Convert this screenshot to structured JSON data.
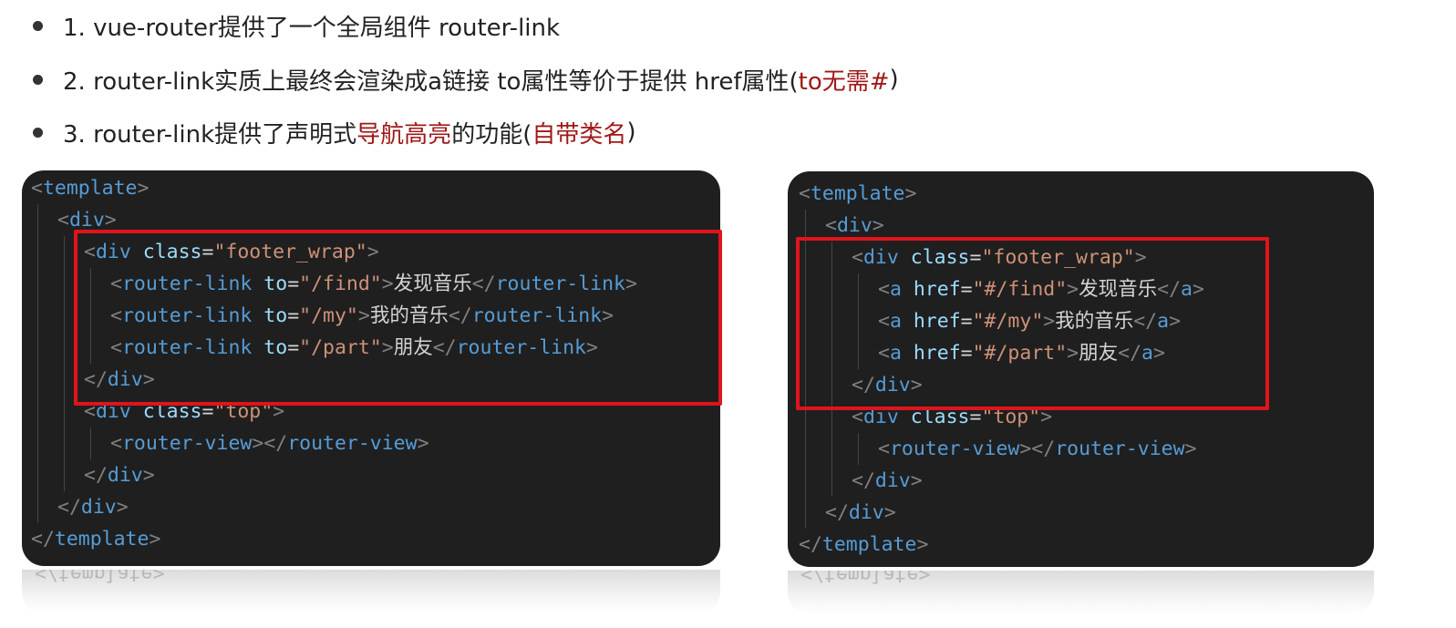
{
  "bullets": [
    {
      "text": "1. vue-router提供了一个全局组件 router-link"
    },
    {
      "pre": "2. router-link实质上最终会渲染成a链接 to属性等价于提供 href属性(",
      "red": "to无需#",
      "post": ")"
    },
    {
      "pre": "3. router-link提供了声明式",
      "red1": "导航高亮",
      "mid": "的功能(",
      "red2": "自带类名",
      "post": ")"
    }
  ],
  "left_code": [
    {
      "i": 0,
      "tokens": [
        [
          "p",
          "<"
        ],
        [
          "t",
          "template"
        ],
        [
          "p",
          ">"
        ]
      ]
    },
    {
      "i": 1,
      "tokens": [
        [
          "p",
          "<"
        ],
        [
          "t",
          "div"
        ],
        [
          "p",
          ">"
        ]
      ]
    },
    {
      "i": 2,
      "tokens": [
        [
          "p",
          "<"
        ],
        [
          "t",
          "div"
        ],
        [
          "x",
          " "
        ],
        [
          "a",
          "class"
        ],
        [
          "x",
          "="
        ],
        [
          "s",
          "\"footer_wrap\""
        ],
        [
          "p",
          ">"
        ]
      ]
    },
    {
      "i": 3,
      "tokens": [
        [
          "p",
          "<"
        ],
        [
          "t",
          "router-link"
        ],
        [
          "x",
          " "
        ],
        [
          "a",
          "to"
        ],
        [
          "x",
          "="
        ],
        [
          "s",
          "\"/find\""
        ],
        [
          "p",
          ">"
        ],
        [
          "x",
          "发现音乐"
        ],
        [
          "p",
          "</"
        ],
        [
          "t",
          "router-link"
        ],
        [
          "p",
          ">"
        ]
      ]
    },
    {
      "i": 3,
      "tokens": [
        [
          "p",
          "<"
        ],
        [
          "t",
          "router-link"
        ],
        [
          "x",
          " "
        ],
        [
          "a",
          "to"
        ],
        [
          "x",
          "="
        ],
        [
          "s",
          "\"/my\""
        ],
        [
          "p",
          ">"
        ],
        [
          "x",
          "我的音乐"
        ],
        [
          "p",
          "</"
        ],
        [
          "t",
          "router-link"
        ],
        [
          "p",
          ">"
        ]
      ]
    },
    {
      "i": 3,
      "tokens": [
        [
          "p",
          "<"
        ],
        [
          "t",
          "router-link"
        ],
        [
          "x",
          " "
        ],
        [
          "a",
          "to"
        ],
        [
          "x",
          "="
        ],
        [
          "s",
          "\"/part\""
        ],
        [
          "p",
          ">"
        ],
        [
          "x",
          "朋友"
        ],
        [
          "p",
          "</"
        ],
        [
          "t",
          "router-link"
        ],
        [
          "p",
          ">"
        ]
      ]
    },
    {
      "i": 2,
      "tokens": [
        [
          "p",
          "</"
        ],
        [
          "t",
          "div"
        ],
        [
          "p",
          ">"
        ]
      ]
    },
    {
      "i": 2,
      "tokens": [
        [
          "p",
          "<"
        ],
        [
          "t",
          "div"
        ],
        [
          "x",
          " "
        ],
        [
          "a",
          "class"
        ],
        [
          "x",
          "="
        ],
        [
          "s",
          "\"top\""
        ],
        [
          "p",
          ">"
        ]
      ]
    },
    {
      "i": 3,
      "tokens": [
        [
          "p",
          "<"
        ],
        [
          "t",
          "router-view"
        ],
        [
          "p",
          "></"
        ],
        [
          "t",
          "router-view"
        ],
        [
          "p",
          ">"
        ]
      ]
    },
    {
      "i": 2,
      "tokens": [
        [
          "p",
          "</"
        ],
        [
          "t",
          "div"
        ],
        [
          "p",
          ">"
        ]
      ]
    },
    {
      "i": 1,
      "tokens": [
        [
          "p",
          "</"
        ],
        [
          "t",
          "div"
        ],
        [
          "p",
          ">"
        ]
      ]
    },
    {
      "i": 0,
      "tokens": [
        [
          "p",
          "</"
        ],
        [
          "t",
          "template"
        ],
        [
          "p",
          ">"
        ]
      ]
    }
  ],
  "right_code": [
    {
      "i": 0,
      "tokens": [
        [
          "p",
          "<"
        ],
        [
          "t",
          "template"
        ],
        [
          "p",
          ">"
        ]
      ]
    },
    {
      "i": 1,
      "tokens": [
        [
          "p",
          "<"
        ],
        [
          "t",
          "div"
        ],
        [
          "p",
          ">"
        ]
      ]
    },
    {
      "i": 2,
      "tokens": [
        [
          "p",
          "<"
        ],
        [
          "t",
          "div"
        ],
        [
          "x",
          " "
        ],
        [
          "a",
          "class"
        ],
        [
          "x",
          "="
        ],
        [
          "s",
          "\"footer_wrap\""
        ],
        [
          "p",
          ">"
        ]
      ]
    },
    {
      "i": 3,
      "tokens": [
        [
          "p",
          "<"
        ],
        [
          "t",
          "a"
        ],
        [
          "x",
          " "
        ],
        [
          "a",
          "href"
        ],
        [
          "x",
          "="
        ],
        [
          "s",
          "\"#/find\""
        ],
        [
          "p",
          ">"
        ],
        [
          "x",
          "发现音乐"
        ],
        [
          "p",
          "</"
        ],
        [
          "t",
          "a"
        ],
        [
          "p",
          ">"
        ]
      ]
    },
    {
      "i": 3,
      "tokens": [
        [
          "p",
          "<"
        ],
        [
          "t",
          "a"
        ],
        [
          "x",
          " "
        ],
        [
          "a",
          "href"
        ],
        [
          "x",
          "="
        ],
        [
          "s",
          "\"#/my\""
        ],
        [
          "p",
          ">"
        ],
        [
          "x",
          "我的音乐"
        ],
        [
          "p",
          "</"
        ],
        [
          "t",
          "a"
        ],
        [
          "p",
          ">"
        ]
      ]
    },
    {
      "i": 3,
      "tokens": [
        [
          "p",
          "<"
        ],
        [
          "t",
          "a"
        ],
        [
          "x",
          " "
        ],
        [
          "a",
          "href"
        ],
        [
          "x",
          "="
        ],
        [
          "s",
          "\"#/part\""
        ],
        [
          "p",
          ">"
        ],
        [
          "x",
          "朋友"
        ],
        [
          "p",
          "</"
        ],
        [
          "t",
          "a"
        ],
        [
          "p",
          ">"
        ]
      ]
    },
    {
      "i": 2,
      "tokens": [
        [
          "p",
          "</"
        ],
        [
          "t",
          "div"
        ],
        [
          "p",
          ">"
        ]
      ]
    },
    {
      "i": 2,
      "tokens": [
        [
          "p",
          "<"
        ],
        [
          "t",
          "div"
        ],
        [
          "x",
          " "
        ],
        [
          "a",
          "class"
        ],
        [
          "x",
          "="
        ],
        [
          "s",
          "\"top\""
        ],
        [
          "p",
          ">"
        ]
      ]
    },
    {
      "i": 3,
      "tokens": [
        [
          "p",
          "<"
        ],
        [
          "t",
          "router-view"
        ],
        [
          "p",
          "></"
        ],
        [
          "t",
          "router-view"
        ],
        [
          "p",
          ">"
        ]
      ]
    },
    {
      "i": 2,
      "tokens": [
        [
          "p",
          "</"
        ],
        [
          "t",
          "div"
        ],
        [
          "p",
          ">"
        ]
      ]
    },
    {
      "i": 1,
      "tokens": [
        [
          "p",
          "</"
        ],
        [
          "t",
          "div"
        ],
        [
          "p",
          ">"
        ]
      ]
    },
    {
      "i": 0,
      "tokens": [
        [
          "p",
          "</"
        ],
        [
          "t",
          "template"
        ],
        [
          "p",
          ">"
        ]
      ]
    }
  ],
  "reflection_text": "</template>",
  "colors": {
    "tag": "#569cd6",
    "attr": "#9cdcfe",
    "string": "#ce9178",
    "punct": "#808080",
    "highlight": "#e0141b",
    "emphasis": "#a01818"
  }
}
